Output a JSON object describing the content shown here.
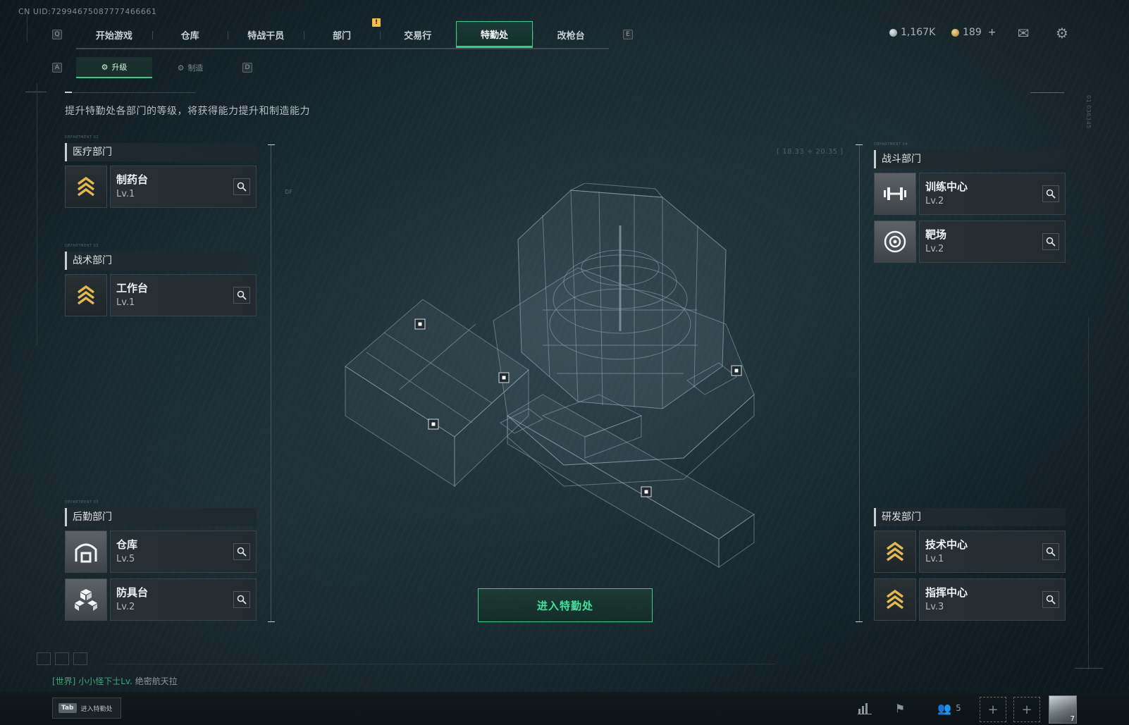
{
  "uid": "CN UID:72994675087777466661",
  "nav": {
    "left_key": "Q",
    "right_key": "E",
    "alert": "!",
    "tabs": [
      "开始游戏",
      "仓库",
      "特战干员",
      "部门",
      "交易行",
      "特勤处",
      "改枪台"
    ],
    "active_tab": "特勤处"
  },
  "currency": {
    "silver": "1,167K",
    "gold": "189",
    "plus": "+"
  },
  "subtabs": {
    "left_key": "A",
    "right_key": "D",
    "upgrade": "升级",
    "craft": "制造"
  },
  "description": "提升特勤处各部门的等级，将获得能力提升和制造能力",
  "departments": {
    "medical": {
      "code": "DEPARTMENT 01",
      "title": "医疗部门",
      "items": [
        {
          "name": "制药台",
          "level": "Lv.1"
        }
      ]
    },
    "tactical": {
      "code": "DEPARTMENT 02",
      "title": "战术部门",
      "items": [
        {
          "name": "工作台",
          "level": "Lv.1"
        }
      ]
    },
    "logistics": {
      "code": "DEPARTMENT 03",
      "title": "后勤部门",
      "items": [
        {
          "name": "仓库",
          "level": "Lv.5"
        },
        {
          "name": "防具台",
          "level": "Lv.2"
        }
      ]
    },
    "combat": {
      "code": "DEPARTMENT 04",
      "title": "战斗部门",
      "items": [
        {
          "name": "训练中心",
          "level": "Lv.2"
        },
        {
          "name": "靶场",
          "level": "Lv.2"
        }
      ]
    },
    "research": {
      "title": "研发部门",
      "items": [
        {
          "name": "技术中心",
          "level": "Lv.1"
        },
        {
          "name": "指挥中心",
          "level": "Lv.3"
        }
      ]
    }
  },
  "hud": {
    "coords": "[ 18.33 + 20.35 ]",
    "side_code": "01 036345",
    "cam_code": "DF"
  },
  "enter_button": "进入特勤处",
  "chat": {
    "channel": "[世界]",
    "user": "小小怪下士Lv.",
    "message": "绝密航天拉"
  },
  "bottom": {
    "tab_key": "Tab",
    "tab_label": "进入特勤处",
    "team_count": "5",
    "avatar_level": "7"
  },
  "colors": {
    "accent": "#2fcf8a",
    "chevron": "#e3b94c"
  }
}
